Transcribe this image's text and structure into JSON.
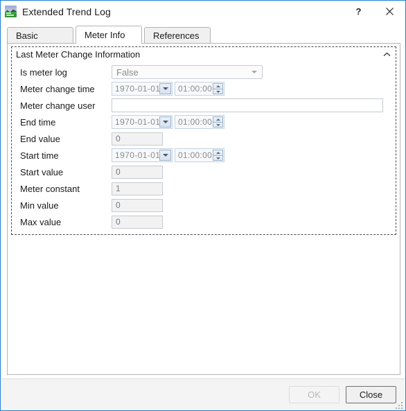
{
  "window": {
    "title": "Extended Trend Log",
    "icon": "trend-log-app-icon",
    "border_color": "#1a7fd4",
    "buttons": {
      "help_label": "?",
      "close_icon": "close-icon"
    }
  },
  "tabs": [
    {
      "label": "Basic",
      "active": false
    },
    {
      "label": "Meter Info",
      "active": true
    },
    {
      "label": "References",
      "active": false
    }
  ],
  "group": {
    "title": "Last Meter Change Information",
    "collapse_icon": "chevron-up-icon",
    "expanded": true
  },
  "fields": [
    {
      "label": "Is meter log",
      "type": "combobox",
      "value": "False",
      "enabled": false,
      "arrow_icon": "chevron-down-icon"
    },
    {
      "label": "Meter change time",
      "type": "datetime",
      "date": "1970-01-01",
      "time": "01:00:00",
      "enabled": false,
      "date_arrow_icon": "chevron-down-icon",
      "spinner_icon": "spinner-up-down-icon"
    },
    {
      "label": "Meter change user",
      "type": "text",
      "value": "",
      "enabled": true
    },
    {
      "label": "End time",
      "type": "datetime",
      "date": "1970-01-01",
      "time": "01:00:00",
      "enabled": false,
      "date_arrow_icon": "chevron-down-icon",
      "spinner_icon": "spinner-up-down-icon"
    },
    {
      "label": "End value",
      "type": "number",
      "value": "0",
      "enabled": false
    },
    {
      "label": "Start time",
      "type": "datetime",
      "date": "1970-01-01",
      "time": "01:00:00",
      "enabled": false,
      "date_arrow_icon": "chevron-down-icon",
      "spinner_icon": "spinner-up-down-icon"
    },
    {
      "label": "Start value",
      "type": "number",
      "value": "0",
      "enabled": false
    },
    {
      "label": "Meter constant",
      "type": "number",
      "value": "1",
      "enabled": false
    },
    {
      "label": "Min value",
      "type": "number",
      "value": "0",
      "enabled": false
    },
    {
      "label": "Max value",
      "type": "number",
      "value": "0",
      "enabled": false
    }
  ],
  "footer": {
    "ok_label": "OK",
    "ok_enabled": false,
    "close_label": "Close",
    "close_enabled": true,
    "resize_grip": "resize-grip-icon"
  }
}
